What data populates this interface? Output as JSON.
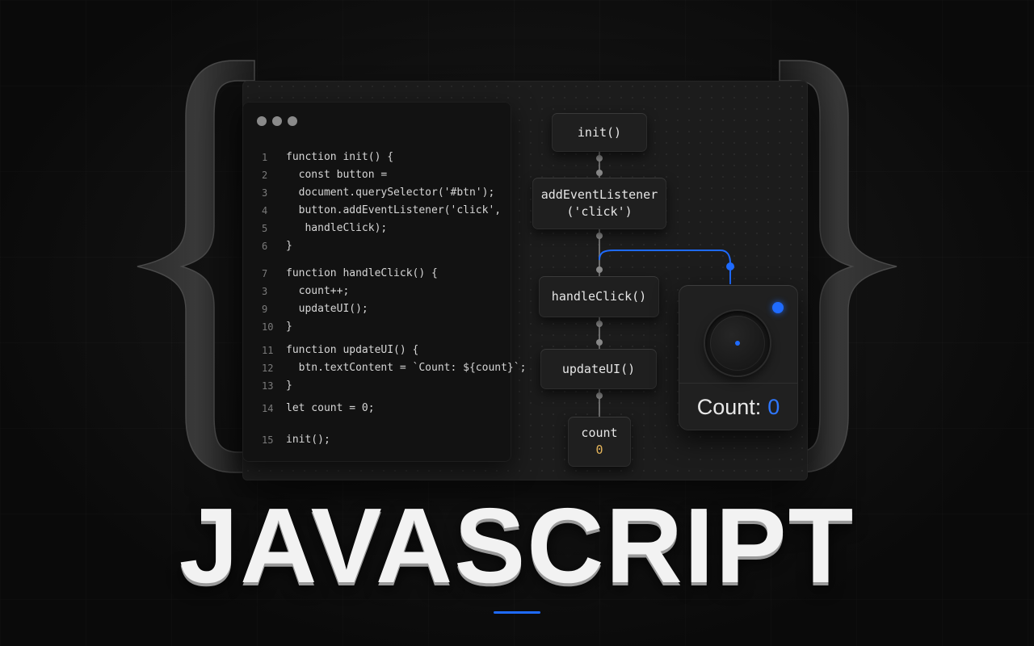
{
  "code": {
    "lines": [
      {
        "num": "1",
        "text": "function init() {"
      },
      {
        "num": "2",
        "text": "  const button ="
      },
      {
        "num": "3",
        "text": "  document.querySelector('#btn');"
      },
      {
        "num": "4",
        "text": "  button.addEventListener('click',"
      },
      {
        "num": "5",
        "text": "   handleClick);"
      },
      {
        "num": "6",
        "text": "}"
      },
      {
        "num": "7",
        "text": "function handleClick() {"
      },
      {
        "num": "3",
        "text": "  count++;"
      },
      {
        "num": "9",
        "text": "  updateUI();"
      },
      {
        "num": "10",
        "text": "}"
      },
      {
        "num": "11",
        "text": "function updateUI() {"
      },
      {
        "num": "12",
        "text": "  btn.textContent = `Count: ${count}`;"
      },
      {
        "num": "13",
        "text": "}"
      },
      {
        "num": "14",
        "text": "let count = 0;"
      },
      {
        "num": "15",
        "text": "init();"
      }
    ]
  },
  "flow": {
    "init": "init()",
    "listener_line1": "addEventListener",
    "listener_line2": "('click')",
    "handle": "handleClick()",
    "update": "updateUI()",
    "count_label": "count",
    "count_value": "0"
  },
  "button_card": {
    "label": "Count:",
    "value": "0"
  },
  "title": "JAVASCRIPT",
  "colors": {
    "accent": "#1f6bff",
    "value": "#e4b45a",
    "background": "#161616"
  }
}
